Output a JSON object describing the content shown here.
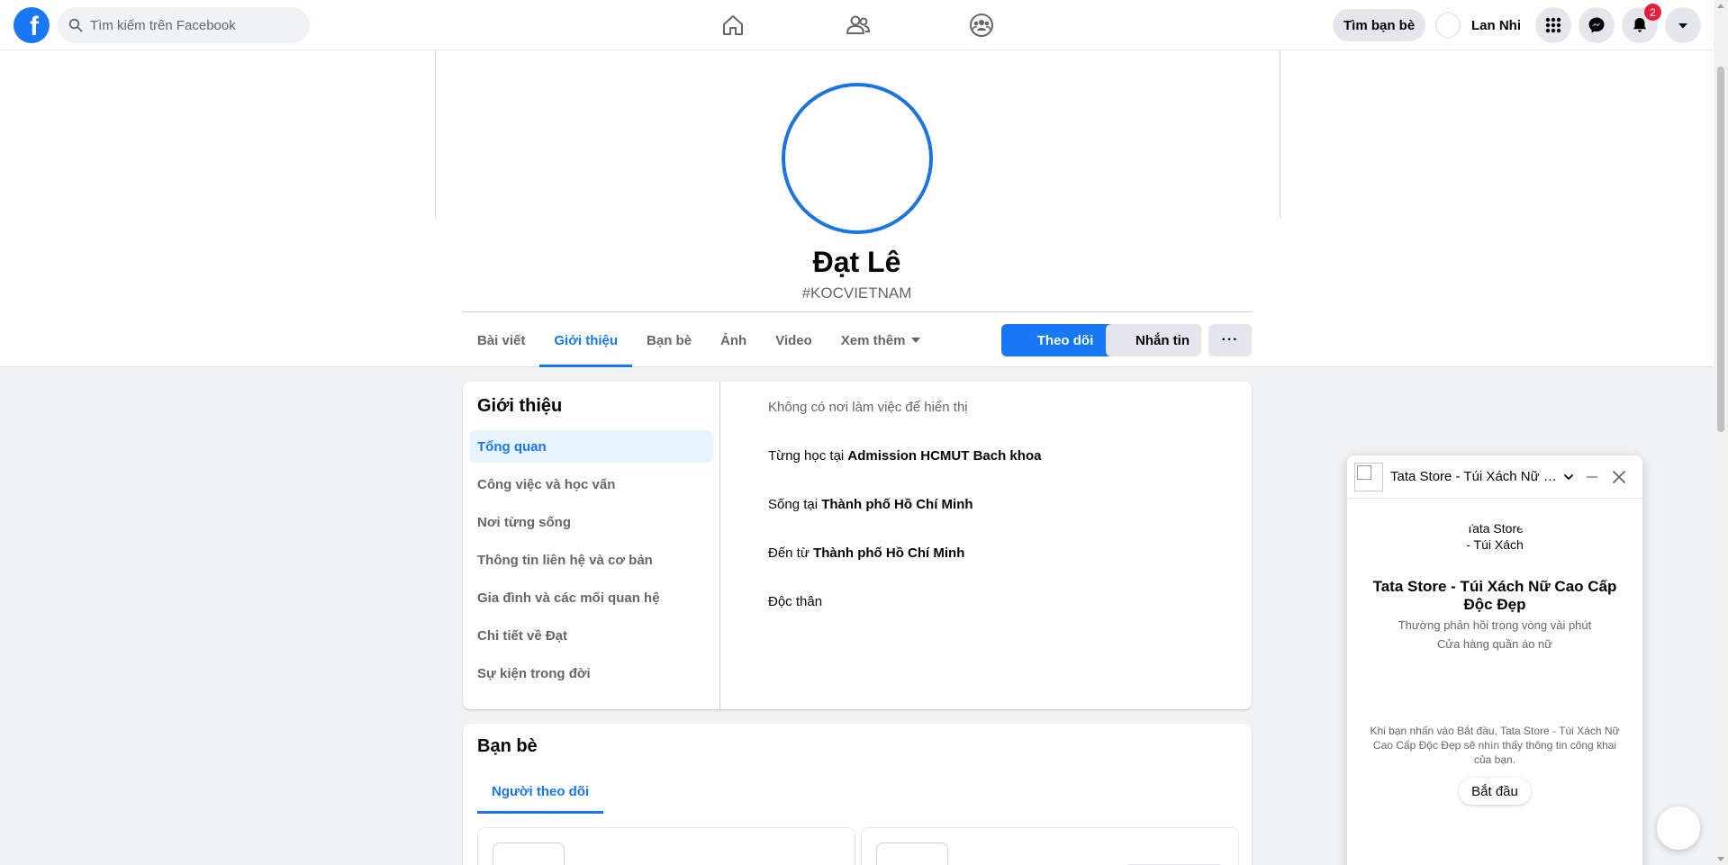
{
  "topbar": {
    "logo": "f",
    "search_placeholder": "Tìm kiếm trên Facebook",
    "nav_icons": [
      "home-icon",
      "friends-icon",
      "groups-icon"
    ],
    "find_friends_label": "Tìm bạn bè",
    "user_name": "Lan Nhi",
    "notification_count": "2"
  },
  "profile": {
    "name": "Đạt Lê",
    "tag": "#KOCVIETNAM",
    "tabs": [
      {
        "label": "Bài viết"
      },
      {
        "label": "Giới thiệu"
      },
      {
        "label": "Bạn bè"
      },
      {
        "label": "Ảnh"
      },
      {
        "label": "Video"
      },
      {
        "label": "Xem thêm"
      }
    ],
    "active_tab": "Giới thiệu",
    "follow_label": "Theo dõi",
    "message_label": "Nhắn tin",
    "more_label": "···"
  },
  "about": {
    "title": "Giới thiệu",
    "menu": [
      {
        "label": "Tổng quan"
      },
      {
        "label": "Công việc và học vấn"
      },
      {
        "label": "Nơi từng sống"
      },
      {
        "label": "Thông tin liên hệ và cơ bản"
      },
      {
        "label": "Gia đình và các mối quan hệ"
      },
      {
        "label": "Chi tiết về Đạt"
      },
      {
        "label": "Sự kiện trong đời"
      }
    ],
    "no_work": "Không có nơi làm việc để hiển thị",
    "studied_prefix": "Từng học tại ",
    "studied_value": "Admission HCMUT Bach khoa",
    "lives_prefix": "Sống tại ",
    "lives_value": "Thành phố Hồ Chí Minh",
    "from_prefix": "Đến từ ",
    "from_value": "Thành phố Hồ Chí Minh",
    "relationship": "Độc thân"
  },
  "friends": {
    "title": "Bạn bè",
    "tab_label": "Người theo dõi"
  },
  "chat": {
    "header_title": "Tata Store - Túi Xách Nữ Cao Cấp Độc Đẹp",
    "avatar_alt": "Tata Store - Túi Xách",
    "page_name": "Tata Store - Túi Xách Nữ Cao Cấp Độc Đẹp",
    "response_time": "Thường phản hồi trong vòng vài phút",
    "category": "Cửa hàng quần áo nữ",
    "privacy_note": "Khi bạn nhấn vào Bắt đầu, Tata Store - Túi Xách Nữ Cao Cấp Độc Đẹp sẽ nhìn thấy thông tin công khai của bạn.",
    "start_label": "Bắt đầu"
  },
  "colors": {
    "accent": "#1877f2",
    "badge": "#e41e3f",
    "background": "#f0f2f5"
  }
}
